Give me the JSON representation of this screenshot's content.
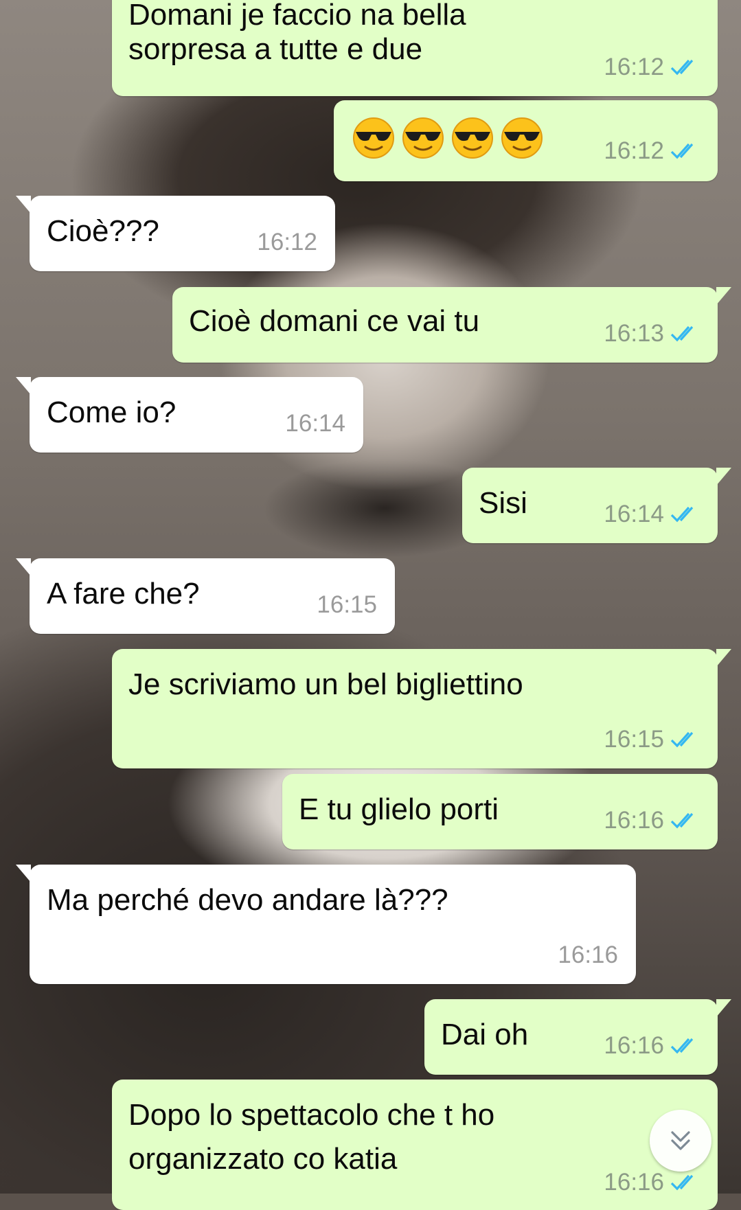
{
  "messages": [
    {
      "dir": "out",
      "lines": [
        "Domani je faccio na bella",
        "sorpresa a tutte e due"
      ],
      "time": "16:12",
      "read": true
    },
    {
      "dir": "out",
      "emoji": "smiling-face-with-sunglasses",
      "emoji_count": 4,
      "time": "16:12",
      "read": true
    },
    {
      "dir": "in",
      "lines": [
        "Cioè???"
      ],
      "time": "16:12"
    },
    {
      "dir": "out",
      "lines": [
        "Cioè domani ce vai tu"
      ],
      "time": "16:13",
      "read": true
    },
    {
      "dir": "in",
      "lines": [
        "Come io?"
      ],
      "time": "16:14"
    },
    {
      "dir": "out",
      "lines": [
        "Sisi"
      ],
      "time": "16:14",
      "read": true
    },
    {
      "dir": "in",
      "lines": [
        "A fare che?"
      ],
      "time": "16:15"
    },
    {
      "dir": "out",
      "lines": [
        "Je scriviamo un bel bigliettino"
      ],
      "time": "16:15",
      "read": true
    },
    {
      "dir": "out",
      "lines": [
        "E tu glielo porti"
      ],
      "time": "16:16",
      "read": true
    },
    {
      "dir": "in",
      "lines": [
        "Ma perché devo andare là???"
      ],
      "time": "16:16"
    },
    {
      "dir": "out",
      "lines": [
        "Dai oh"
      ],
      "time": "16:16",
      "read": true
    },
    {
      "dir": "out",
      "lines": [
        "Dopo lo spettacolo che t ho",
        "organizzato co katia"
      ],
      "time": "16:16",
      "read": true
    }
  ],
  "colors": {
    "outgoing_bubble": "#e2ffc7",
    "incoming_bubble": "#ffffff",
    "read_check": "#34b7f1"
  },
  "scroll_button_icon": "chevron-double-down-icon"
}
